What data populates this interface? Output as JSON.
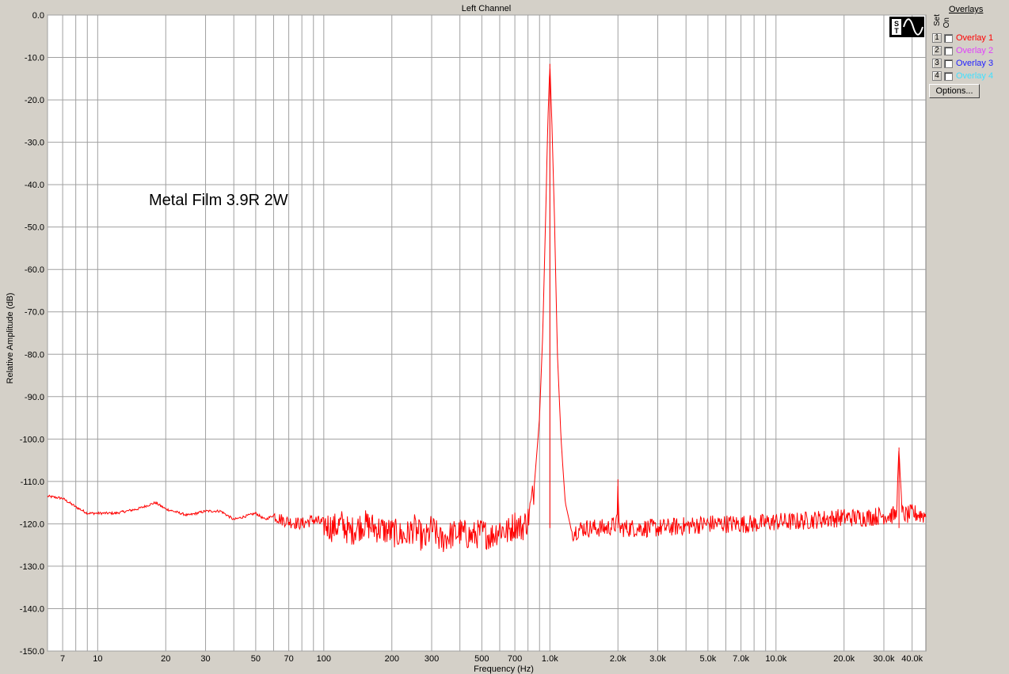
{
  "chart_data": {
    "type": "line",
    "title": "Left Channel",
    "xlabel": "Frequency (Hz)",
    "ylabel": "Relative Amplitude (dB)",
    "annotation": "Metal Film 3.9R 2W",
    "x_scale": "log",
    "xlim": [
      6,
      46000
    ],
    "ylim": [
      -150,
      0
    ],
    "grid": true,
    "y_ticks": [
      "0.0",
      "-10.0",
      "-20.0",
      "-30.0",
      "-40.0",
      "-50.0",
      "-60.0",
      "-70.0",
      "-80.0",
      "-90.0",
      "-100.0",
      "-110.0",
      "-120.0",
      "-130.0",
      "-140.0",
      "-150.0"
    ],
    "x_ticks": [
      {
        "v": 7,
        "label": "7"
      },
      {
        "v": 10,
        "label": "10"
      },
      {
        "v": 20,
        "label": "20"
      },
      {
        "v": 30,
        "label": "30"
      },
      {
        "v": 50,
        "label": "50"
      },
      {
        "v": 70,
        "label": "70"
      },
      {
        "v": 100,
        "label": "100"
      },
      {
        "v": 200,
        "label": "200"
      },
      {
        "v": 300,
        "label": "300"
      },
      {
        "v": 500,
        "label": "500"
      },
      {
        "v": 700,
        "label": "700"
      },
      {
        "v": 1000,
        "label": "1.0k"
      },
      {
        "v": 2000,
        "label": "2.0k"
      },
      {
        "v": 3000,
        "label": "3.0k"
      },
      {
        "v": 5000,
        "label": "5.0k"
      },
      {
        "v": 7000,
        "label": "7.0k"
      },
      {
        "v": 10000,
        "label": "10.0k"
      },
      {
        "v": 20000,
        "label": "20.0k"
      },
      {
        "v": 30000,
        "label": "30.0k"
      },
      {
        "v": 40000,
        "label": "40.0k"
      }
    ],
    "series": [
      {
        "color": "#ff0000",
        "x": [
          6,
          7,
          8,
          9,
          10,
          12,
          15,
          18,
          20,
          25,
          30,
          35,
          40,
          50,
          55,
          60,
          65,
          70,
          80,
          90,
          100,
          110,
          120,
          130,
          150,
          170,
          200,
          230,
          250,
          280,
          300,
          330,
          350,
          400,
          450,
          500,
          550,
          600,
          650,
          700,
          750,
          800,
          850,
          900,
          930,
          960,
          980,
          1000,
          1020,
          1050,
          1080,
          1120,
          1170,
          1250,
          1400,
          1600,
          1800,
          1980,
          2000,
          2020,
          2200,
          2500,
          3000,
          4000,
          5000,
          6000,
          7000,
          8000,
          10000,
          12000,
          15000,
          20000,
          25000,
          30000,
          34000,
          35000,
          36000,
          38000,
          40000,
          46000
        ],
        "y": [
          -113.5,
          -114,
          -116,
          -117.5,
          -117.5,
          -117.5,
          -116.5,
          -115,
          -116.5,
          -118,
          -117,
          -117,
          -119,
          -117.5,
          -119,
          -118,
          -119,
          -119.5,
          -120,
          -119,
          -120,
          -121,
          -120,
          -122,
          -120,
          -121,
          -122,
          -123,
          -121,
          -124,
          -121,
          -124,
          -123,
          -122,
          -123,
          -122,
          -123,
          -121,
          -122,
          -120,
          -121,
          -119,
          -112,
          -95,
          -75,
          -45,
          -25,
          -11.5,
          -25,
          -50,
          -80,
          -100,
          -115,
          -122,
          -121,
          -121,
          -121,
          -120,
          -109.5,
          -121,
          -121,
          -121,
          -121,
          -120.5,
          -120,
          -120,
          -120,
          -120,
          -119.5,
          -119.5,
          -119,
          -118.5,
          -118.5,
          -118,
          -118,
          -102,
          -117.5,
          -118,
          -117.5,
          -118
        ]
      }
    ]
  },
  "overlays": {
    "title": "Overlays",
    "col_set": "Set",
    "col_on": "On",
    "items": [
      {
        "num": "1",
        "label": "Overlay 1",
        "color": "#ff0000"
      },
      {
        "num": "2",
        "label": "Overlay 2",
        "color": "#e040fb"
      },
      {
        "num": "3",
        "label": "Overlay 3",
        "color": "#2020ff"
      },
      {
        "num": "4",
        "label": "Overlay 4",
        "color": "#40e0ff"
      }
    ],
    "options_label": "Options..."
  }
}
